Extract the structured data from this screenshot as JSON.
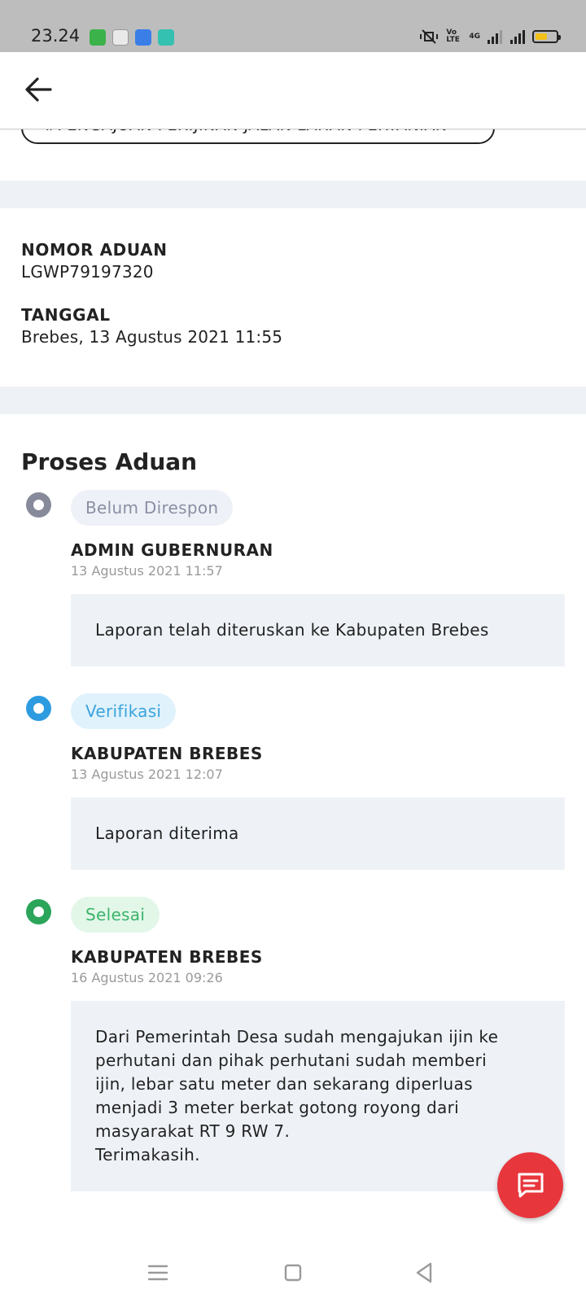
{
  "status_bar": {
    "time": "23.24",
    "volte_label": "Vo LTE",
    "network_label": "4G"
  },
  "header": {
    "back_icon": "arrow-left-icon"
  },
  "complaint": {
    "tag": "#PENGAJUAN PERIJINAN JALAN LAHAN PERTANIAN",
    "number_label": "NOMOR ADUAN",
    "number_value": "LGWP79197320",
    "date_label": "TANGGAL",
    "date_value": "Brebes, 13 Agustus 2021 11:55"
  },
  "process": {
    "title": "Proses Aduan",
    "items": [
      {
        "status": "Belum Direspon",
        "status_color": "#878a9a",
        "badge_bg": "#eef1f7",
        "badge_color": "#8a8fa3",
        "actor": "ADMIN GUBERNURAN",
        "timestamp": "13 Agustus 2021 11:57",
        "message": [
          "Laporan telah diteruskan ke Kabupaten Brebes"
        ]
      },
      {
        "status": "Verifikasi",
        "status_color": "#2d9be0",
        "badge_bg": "#e0f2fc",
        "badge_color": "#3aa3dd",
        "actor": "KABUPATEN BREBES",
        "timestamp": "13 Agustus 2021 12:07",
        "message": [
          "Laporan diterima"
        ]
      },
      {
        "status": "Selesai",
        "status_color": "#2aa55a",
        "badge_bg": "#e3f7e9",
        "badge_color": "#3cb36a",
        "actor": "KABUPATEN BREBES",
        "timestamp": "16 Agustus 2021 09:26",
        "message": [
          "Dari Pemerintah Desa sudah mengajukan ijin ke",
          "perhutani dan pihak perhutani sudah memberi",
          "ijin, lebar satu meter dan sekarang diperluas",
          "menjadi 3 meter berkat gotong royong dari",
          "masyarakat RT 9 RW 7.",
          "Terimakasih."
        ]
      }
    ]
  },
  "fab": {
    "icon": "chat-icon",
    "color": "#e8363d"
  },
  "navigation": {
    "icons": [
      "menu-icon",
      "home-icon",
      "back-icon"
    ]
  }
}
